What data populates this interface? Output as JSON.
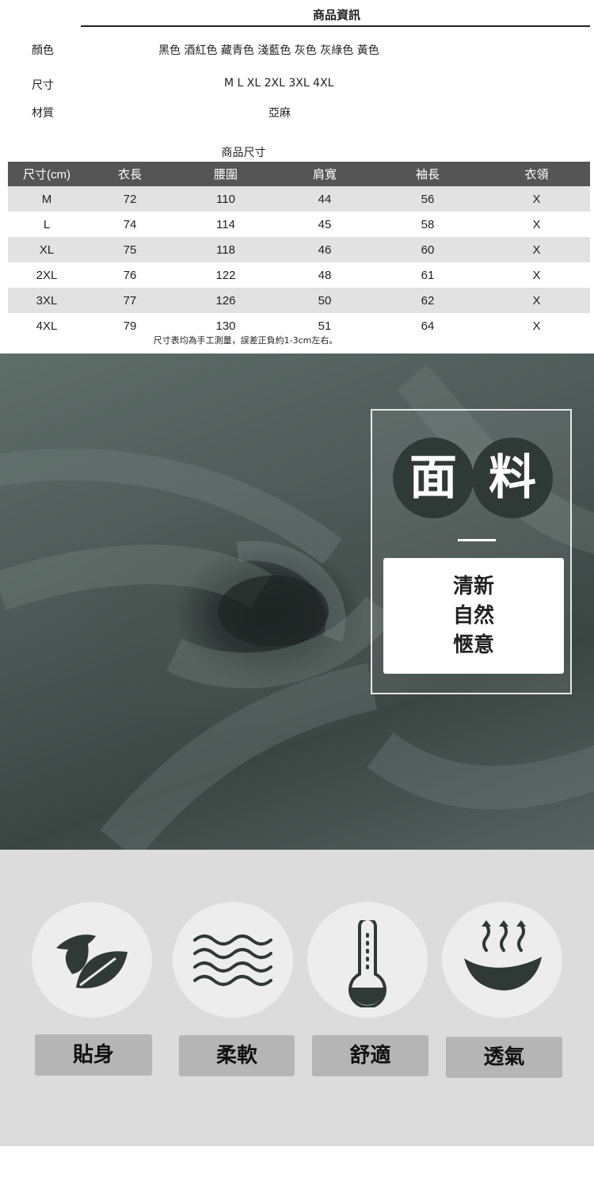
{
  "product_info": {
    "title": "商品資訊",
    "rows": [
      {
        "label": "顏色",
        "value": "黑色 酒紅色 藏青色 淺藍色 灰色 灰綠色 黃色"
      },
      {
        "label": "尺寸",
        "value": "M L XL 2XL 3XL 4XL"
      },
      {
        "label": "材質",
        "value": "亞麻"
      }
    ]
  },
  "size_table": {
    "title": "商品尺寸",
    "headers": [
      "尺寸(cm)",
      "衣長",
      "腰圍",
      "肩寬",
      "袖長",
      "衣領"
    ],
    "rows": [
      [
        "M",
        "72",
        "110",
        "44",
        "56",
        "X"
      ],
      [
        "L",
        "74",
        "114",
        "45",
        "58",
        "X"
      ],
      [
        "XL",
        "75",
        "118",
        "46",
        "60",
        "X"
      ],
      [
        "2XL",
        "76",
        "122",
        "48",
        "61",
        "X"
      ],
      [
        "3XL",
        "77",
        "126",
        "50",
        "62",
        "X"
      ],
      [
        "4XL",
        "79",
        "130",
        "51",
        "64",
        "X"
      ]
    ],
    "note": "尺寸表均為手工測量，誤差正負約1-3cm左右。"
  },
  "fabric": {
    "heading_chars": [
      "面",
      "料"
    ],
    "lines": [
      "清新",
      "自然",
      "愜意"
    ]
  },
  "features": [
    {
      "icon": "leaves-icon",
      "label": "貼身"
    },
    {
      "icon": "waves-icon",
      "label": "柔軟"
    },
    {
      "icon": "thermometer-icon",
      "label": "舒適"
    },
    {
      "icon": "steam-icon",
      "label": "透氣"
    }
  ],
  "colors": {
    "table_header_bg": "#555555",
    "row_shade": "#e2e2e2",
    "icon_dark": "#2f3936",
    "label_bg": "#b5b5b5"
  }
}
